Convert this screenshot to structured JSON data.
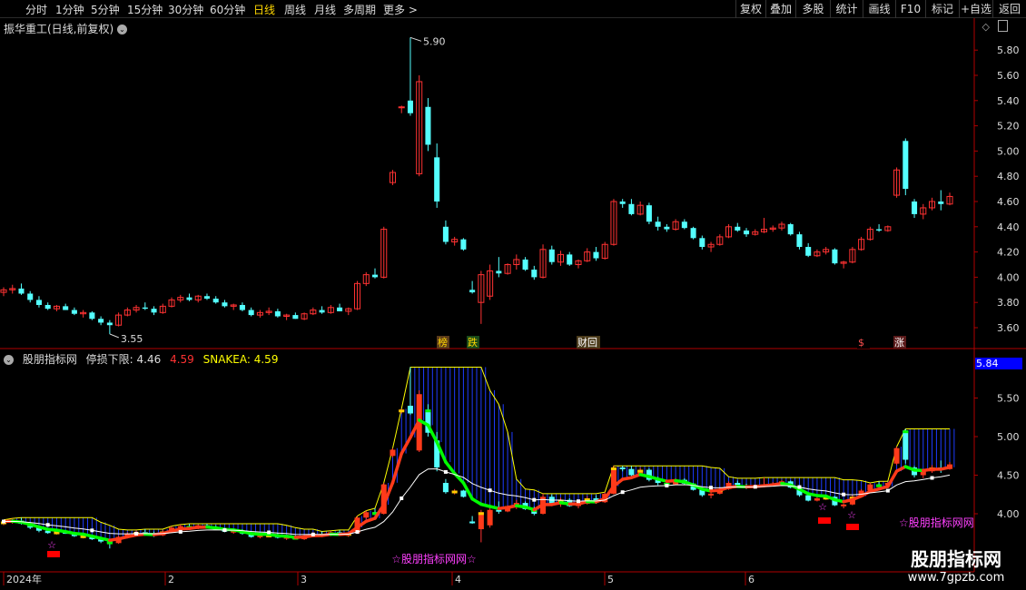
{
  "toolbar": {
    "periods": [
      "分时",
      "1分钟",
      "5分钟",
      "15分钟",
      "30分钟",
      "60分钟",
      "日线",
      "周线",
      "月线",
      "多周期",
      "更多 >"
    ],
    "active_period": "日线",
    "buttons": [
      "复权",
      "叠加",
      "多股",
      "统计",
      "画线",
      "F10",
      "标记",
      "+自选",
      "返回"
    ]
  },
  "main_chart": {
    "title": "振华重工(日线,前复权)",
    "price_axis": [
      "5.80",
      "5.60",
      "5.40",
      "5.20",
      "5.00",
      "4.80",
      "4.60",
      "4.40",
      "4.20",
      "4.00",
      "3.80",
      "3.60"
    ],
    "high_marker": "5.90",
    "low_marker": "3.55",
    "event_tags": [
      "榜",
      "跌",
      "财回",
      "$",
      "涨"
    ]
  },
  "indicator": {
    "name": "股朋指标网",
    "stop_label": "停损下限: 4.46",
    "value2": "4.59",
    "snake_label": "SNAKEA: 4.59",
    "axis": [
      "5.50",
      "5.00",
      "4.50",
      "4.00"
    ],
    "current_box": "5.84",
    "watermark_center": "☆股朋指标网网☆",
    "watermark_right": "☆股朋指标网网"
  },
  "date_axis": [
    "2024年",
    "2",
    "3",
    "4",
    "5",
    "6"
  ],
  "brand": {
    "name": "股朋指标网",
    "url": "www.7gpzb.com"
  },
  "colors": {
    "up": "#ff3232",
    "down": "#54ffff",
    "ma": "#ffffff",
    "snake": "#ffff00",
    "green_band": "#00ff00"
  },
  "chart_data": {
    "type": "candlestick",
    "candles": [
      [
        3.88,
        3.92,
        3.85,
        3.9
      ],
      [
        3.9,
        3.94,
        3.87,
        3.91
      ],
      [
        3.91,
        3.95,
        3.86,
        3.87
      ],
      [
        3.87,
        3.89,
        3.8,
        3.82
      ],
      [
        3.82,
        3.85,
        3.76,
        3.78
      ],
      [
        3.78,
        3.8,
        3.74,
        3.75
      ],
      [
        3.75,
        3.78,
        3.73,
        3.77
      ],
      [
        3.77,
        3.79,
        3.74,
        3.74
      ],
      [
        3.74,
        3.76,
        3.7,
        3.71
      ],
      [
        3.71,
        3.74,
        3.68,
        3.72
      ],
      [
        3.72,
        3.73,
        3.66,
        3.67
      ],
      [
        3.67,
        3.69,
        3.62,
        3.64
      ],
      [
        3.64,
        3.66,
        3.55,
        3.62
      ],
      [
        3.62,
        3.72,
        3.61,
        3.7
      ],
      [
        3.7,
        3.76,
        3.69,
        3.74
      ],
      [
        3.74,
        3.78,
        3.72,
        3.76
      ],
      [
        3.76,
        3.8,
        3.74,
        3.75
      ],
      [
        3.75,
        3.77,
        3.7,
        3.72
      ],
      [
        3.72,
        3.79,
        3.71,
        3.77
      ],
      [
        3.77,
        3.84,
        3.76,
        3.82
      ],
      [
        3.82,
        3.86,
        3.8,
        3.84
      ],
      [
        3.84,
        3.87,
        3.81,
        3.82
      ],
      [
        3.82,
        3.86,
        3.8,
        3.85
      ],
      [
        3.85,
        3.87,
        3.82,
        3.83
      ],
      [
        3.83,
        3.85,
        3.79,
        3.8
      ],
      [
        3.8,
        3.82,
        3.76,
        3.77
      ],
      [
        3.77,
        3.79,
        3.74,
        3.78
      ],
      [
        3.78,
        3.8,
        3.73,
        3.74
      ],
      [
        3.74,
        3.76,
        3.69,
        3.7
      ],
      [
        3.7,
        3.74,
        3.68,
        3.72
      ],
      [
        3.72,
        3.76,
        3.7,
        3.73
      ],
      [
        3.73,
        3.75,
        3.68,
        3.69
      ],
      [
        3.69,
        3.71,
        3.66,
        3.7
      ],
      [
        3.7,
        3.72,
        3.67,
        3.67
      ],
      [
        3.67,
        3.72,
        3.66,
        3.71
      ],
      [
        3.71,
        3.76,
        3.7,
        3.74
      ],
      [
        3.74,
        3.77,
        3.71,
        3.72
      ],
      [
        3.72,
        3.78,
        3.71,
        3.76
      ],
      [
        3.76,
        3.79,
        3.73,
        3.73
      ],
      [
        3.73,
        3.76,
        3.7,
        3.75
      ],
      [
        3.75,
        3.97,
        3.74,
        3.95
      ],
      [
        3.95,
        4.04,
        3.93,
        4.02
      ],
      [
        4.02,
        4.07,
        3.99,
        4.0
      ],
      [
        4.0,
        4.4,
        3.99,
        4.38
      ],
      [
        4.75,
        4.85,
        4.73,
        4.83
      ],
      [
        5.35,
        5.36,
        5.3,
        5.35
      ],
      [
        5.4,
        5.9,
        5.28,
        5.3
      ],
      [
        4.82,
        5.6,
        4.8,
        5.55
      ],
      [
        5.35,
        5.42,
        5.0,
        5.05
      ],
      [
        4.95,
        5.06,
        4.55,
        4.6
      ],
      [
        4.4,
        4.45,
        4.26,
        4.28
      ],
      [
        4.28,
        4.32,
        4.25,
        4.3
      ],
      [
        4.3,
        4.31,
        4.21,
        4.22
      ],
      [
        3.9,
        3.97,
        3.87,
        3.88
      ],
      [
        3.8,
        4.05,
        3.63,
        4.02
      ],
      [
        3.85,
        4.1,
        3.82,
        4.05
      ],
      [
        4.05,
        4.16,
        4.0,
        4.03
      ],
      [
        4.03,
        4.11,
        4.02,
        4.1
      ],
      [
        4.1,
        4.18,
        4.06,
        4.14
      ],
      [
        4.14,
        4.16,
        4.05,
        4.06
      ],
      [
        4.06,
        4.09,
        3.98,
        4.0
      ],
      [
        4.0,
        4.26,
        3.99,
        4.22
      ],
      [
        4.22,
        4.25,
        4.1,
        4.12
      ],
      [
        4.12,
        4.21,
        4.09,
        4.18
      ],
      [
        4.18,
        4.2,
        4.09,
        4.1
      ],
      [
        4.1,
        4.14,
        4.07,
        4.13
      ],
      [
        4.13,
        4.23,
        4.12,
        4.2
      ],
      [
        4.2,
        4.24,
        4.13,
        4.15
      ],
      [
        4.15,
        4.28,
        4.14,
        4.26
      ],
      [
        4.26,
        4.62,
        4.25,
        4.6
      ],
      [
        4.6,
        4.62,
        4.55,
        4.58
      ],
      [
        4.58,
        4.62,
        4.49,
        4.5
      ],
      [
        4.5,
        4.6,
        4.49,
        4.57
      ],
      [
        4.57,
        4.59,
        4.42,
        4.44
      ],
      [
        4.44,
        4.48,
        4.37,
        4.4
      ],
      [
        4.4,
        4.42,
        4.36,
        4.38
      ],
      [
        4.38,
        4.46,
        4.37,
        4.44
      ],
      [
        4.44,
        4.46,
        4.38,
        4.39
      ],
      [
        4.39,
        4.4,
        4.3,
        4.31
      ],
      [
        4.31,
        4.33,
        4.22,
        4.24
      ],
      [
        4.24,
        4.28,
        4.2,
        4.26
      ],
      [
        4.26,
        4.34,
        4.25,
        4.32
      ],
      [
        4.32,
        4.42,
        4.31,
        4.4
      ],
      [
        4.4,
        4.43,
        4.36,
        4.37
      ],
      [
        4.37,
        4.39,
        4.32,
        4.34
      ],
      [
        4.34,
        4.38,
        4.33,
        4.36
      ],
      [
        4.36,
        4.47,
        4.35,
        4.38
      ],
      [
        4.38,
        4.41,
        4.36,
        4.39
      ],
      [
        4.39,
        4.44,
        4.37,
        4.42
      ],
      [
        4.42,
        4.43,
        4.33,
        4.34
      ],
      [
        4.34,
        4.36,
        4.22,
        4.24
      ],
      [
        4.24,
        4.27,
        4.16,
        4.17
      ],
      [
        4.17,
        4.22,
        4.16,
        4.2
      ],
      [
        4.2,
        4.24,
        4.18,
        4.22
      ],
      [
        4.22,
        4.23,
        4.1,
        4.11
      ],
      [
        4.11,
        4.13,
        4.07,
        4.12
      ],
      [
        4.12,
        4.24,
        4.11,
        4.22
      ],
      [
        4.22,
        4.32,
        4.21,
        4.3
      ],
      [
        4.3,
        4.4,
        4.29,
        4.38
      ],
      [
        4.38,
        4.42,
        4.36,
        4.37
      ],
      [
        4.37,
        4.41,
        4.36,
        4.4
      ],
      [
        4.65,
        4.87,
        4.63,
        4.85
      ],
      [
        5.08,
        5.1,
        4.65,
        4.7
      ],
      [
        4.6,
        4.62,
        4.47,
        4.5
      ],
      [
        4.5,
        4.58,
        4.46,
        4.55
      ],
      [
        4.55,
        4.63,
        4.53,
        4.6
      ],
      [
        4.6,
        4.69,
        4.53,
        4.58
      ],
      [
        4.58,
        4.67,
        4.57,
        4.64
      ]
    ]
  }
}
